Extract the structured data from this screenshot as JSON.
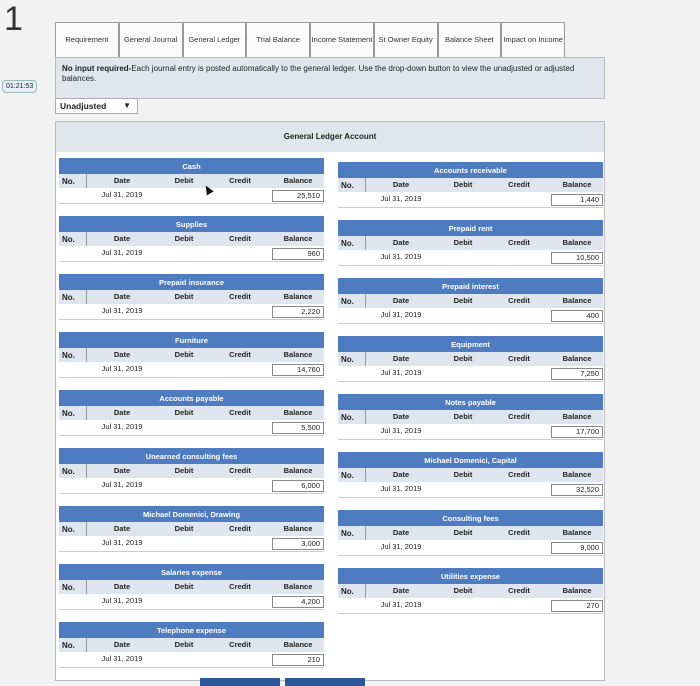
{
  "question_number": "1",
  "timer": "01:21:53",
  "tabs": [
    {
      "label": "Requirement"
    },
    {
      "label": "General Journal"
    },
    {
      "label": "General Ledger"
    },
    {
      "label": "Trial Balance"
    },
    {
      "label": "Income Statement"
    },
    {
      "label": "St Owner Equity"
    },
    {
      "label": "Balance Sheet"
    },
    {
      "label": "Impact on Income"
    }
  ],
  "instructions": {
    "bold": "No input required-",
    "text": "Each journal entry is posted automatically to the general ledger. Use the drop-down button to view the unadjusted or adjusted balances."
  },
  "dropdown": {
    "value": "Unadjusted"
  },
  "ledger": {
    "title": "General Ledger Account",
    "headers": {
      "no": "No.",
      "date": "Date",
      "debit": "Debit",
      "credit": "Credit",
      "balance": "Balance"
    },
    "left": [
      {
        "name": "Cash",
        "date": "Jul 31, 2019",
        "balance": "25,510"
      },
      {
        "name": "Supplies",
        "date": "Jul 31, 2019",
        "balance": "960"
      },
      {
        "name": "Prepaid insurance",
        "date": "Jul 31, 2019",
        "balance": "2,220"
      },
      {
        "name": "Furniture",
        "date": "Jul 31, 2019",
        "balance": "14,760"
      },
      {
        "name": "Accounts payable",
        "date": "Jul 31, 2019",
        "balance": "5,500"
      },
      {
        "name": "Unearned consulting fees",
        "date": "Jul 31, 2019",
        "balance": "6,000"
      },
      {
        "name": "Michael Domenici, Drawing",
        "date": "Jul 31, 2019",
        "balance": "3,000"
      },
      {
        "name": "Salaries expense",
        "date": "Jul 31, 2019",
        "balance": "4,200"
      },
      {
        "name": "Telephone expense",
        "date": "Jul 31, 2019",
        "balance": "210"
      }
    ],
    "right": [
      {
        "name": "Accounts receivable",
        "date": "Jul 31, 2019",
        "balance": "1,440"
      },
      {
        "name": "Prepaid rent",
        "date": "Jul 31, 2019",
        "balance": "10,500"
      },
      {
        "name": "Prepaid interest",
        "date": "Jul 31, 2019",
        "balance": "400"
      },
      {
        "name": "Equipment",
        "date": "Jul 31, 2019",
        "balance": "7,250"
      },
      {
        "name": "Notes payable",
        "date": "Jul 31, 2019",
        "balance": "17,700"
      },
      {
        "name": "Michael Domenici, Capital",
        "date": "Jul 31, 2019",
        "balance": "32,520"
      },
      {
        "name": "Consulting fees",
        "date": "Jul 31, 2019",
        "balance": "9,000"
      },
      {
        "name": "Utilities expense",
        "date": "Jul 31, 2019",
        "balance": "270"
      }
    ]
  }
}
